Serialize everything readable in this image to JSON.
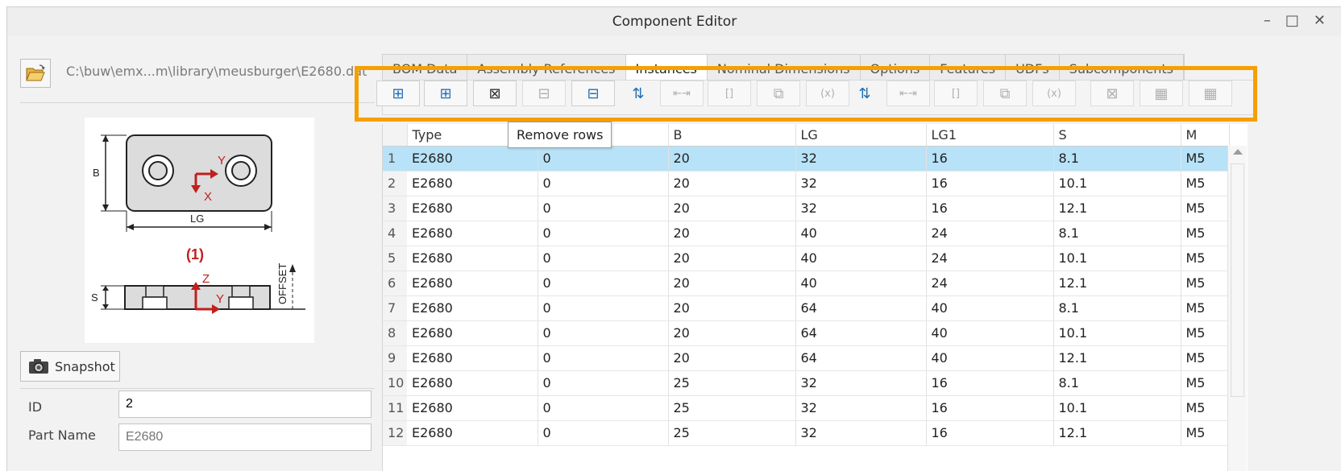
{
  "window": {
    "title": "Component Editor",
    "controls": [
      "–",
      "□",
      "✕"
    ]
  },
  "left": {
    "path": "C:\\buw\\emx...m\\library\\meusburger\\E2680.dat",
    "snapshot_label": "Snapshot",
    "diagram": {
      "label_b": "B",
      "label_lg": "LG",
      "label_x": "X",
      "label_y_top": "Y",
      "label_one": "(1)",
      "label_s": "S",
      "label_z": "Z",
      "label_y_bottom": "Y",
      "label_offset": "OFFSET"
    },
    "fields": [
      {
        "label": "ID",
        "value": "2",
        "placeholder": ""
      },
      {
        "label": "Part Name",
        "value": "",
        "placeholder": "E2680"
      }
    ]
  },
  "tabs": [
    {
      "label": "BOM Data",
      "active": false
    },
    {
      "label": "Assembly References",
      "active": false
    },
    {
      "label": "Instances",
      "active": true
    },
    {
      "label": "Nominal Dimensions",
      "active": false
    },
    {
      "label": "Options",
      "active": false
    },
    {
      "label": "Features",
      "active": false
    },
    {
      "label": "UDFs",
      "active": false
    },
    {
      "label": "Subcomponents",
      "active": false
    }
  ],
  "toolbar": {
    "tooltip": "Remove rows",
    "buttons": [
      {
        "name": "insert-row-before",
        "glyph": "⊞",
        "disabled": false
      },
      {
        "name": "insert-row-after",
        "glyph": "⊞",
        "disabled": false
      },
      {
        "name": "remove-rows",
        "glyph": "⊠",
        "disabled": false
      },
      {
        "name": "copy-row",
        "glyph": "⊟",
        "disabled": true
      },
      {
        "name": "paste-row",
        "glyph": "⊟",
        "disabled": false
      },
      {
        "name": "insert-column-left",
        "glyph": "⇅",
        "disabled": false
      },
      {
        "name": "fit-width-1",
        "glyph": "⇤⇥",
        "disabled": true
      },
      {
        "name": "brackets-1",
        "glyph": "[]",
        "disabled": true
      },
      {
        "name": "copy-1",
        "glyph": "⧉",
        "disabled": true
      },
      {
        "name": "expression-1",
        "glyph": "(x)",
        "disabled": true
      },
      {
        "name": "insert-column-right",
        "glyph": "⇅",
        "disabled": false
      },
      {
        "name": "fit-width-2",
        "glyph": "⇤⇥",
        "disabled": true
      },
      {
        "name": "brackets-2",
        "glyph": "[]",
        "disabled": true
      },
      {
        "name": "copy-2",
        "glyph": "⧉",
        "disabled": true
      },
      {
        "name": "expression-2",
        "glyph": "(x)",
        "disabled": true
      },
      {
        "name": "remove-columns",
        "glyph": "⊠",
        "disabled": true
      },
      {
        "name": "import-table",
        "glyph": "▦",
        "disabled": true
      },
      {
        "name": "export-table",
        "glyph": "▦",
        "disabled": true
      }
    ]
  },
  "table": {
    "headers": [
      "",
      "Type",
      "OFFSET",
      "B",
      "LG",
      "LG1",
      "S",
      "M"
    ],
    "rows": [
      [
        "1",
        "E2680",
        "0",
        "20",
        "32",
        "16",
        "8.1",
        "M5"
      ],
      [
        "2",
        "E2680",
        "0",
        "20",
        "32",
        "16",
        "10.1",
        "M5"
      ],
      [
        "3",
        "E2680",
        "0",
        "20",
        "32",
        "16",
        "12.1",
        "M5"
      ],
      [
        "4",
        "E2680",
        "0",
        "20",
        "40",
        "24",
        "8.1",
        "M5"
      ],
      [
        "5",
        "E2680",
        "0",
        "20",
        "40",
        "24",
        "10.1",
        "M5"
      ],
      [
        "6",
        "E2680",
        "0",
        "20",
        "40",
        "24",
        "12.1",
        "M5"
      ],
      [
        "7",
        "E2680",
        "0",
        "20",
        "64",
        "40",
        "8.1",
        "M5"
      ],
      [
        "8",
        "E2680",
        "0",
        "20",
        "64",
        "40",
        "10.1",
        "M5"
      ],
      [
        "9",
        "E2680",
        "0",
        "20",
        "64",
        "40",
        "12.1",
        "M5"
      ],
      [
        "10",
        "E2680",
        "0",
        "25",
        "32",
        "16",
        "8.1",
        "M5"
      ],
      [
        "11",
        "E2680",
        "0",
        "25",
        "32",
        "16",
        "10.1",
        "M5"
      ],
      [
        "12",
        "E2680",
        "0",
        "25",
        "32",
        "16",
        "12.1",
        "M5"
      ]
    ],
    "selected_row": 1
  },
  "colors": {
    "highlight": "#f5a000",
    "selection": "#b8e2f8",
    "diagram_red": "#c0201e"
  }
}
